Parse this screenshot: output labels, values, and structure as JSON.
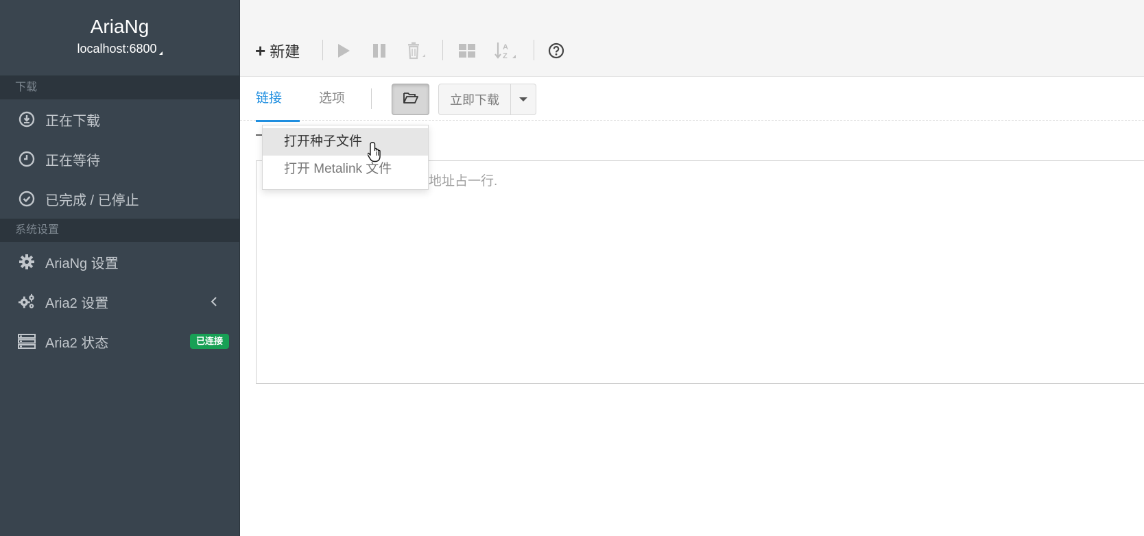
{
  "sidebar": {
    "brand": {
      "title": "AriaNg",
      "host": "localhost:6800"
    },
    "sections": [
      {
        "header": "下载"
      },
      {
        "header": "系统设置"
      }
    ],
    "download_items": [
      {
        "label": "正在下载",
        "icon": "download-circle-icon"
      },
      {
        "label": "正在等待",
        "icon": "clock-icon"
      },
      {
        "label": "已完成 / 已停止",
        "icon": "check-circle-icon"
      }
    ],
    "settings_items": [
      {
        "label": "AriaNg 设置",
        "icon": "gear-icon"
      },
      {
        "label": "Aria2 设置",
        "icon": "gears-icon"
      },
      {
        "label": "Aria2 状态",
        "icon": "server-icon",
        "badge": "已连接"
      }
    ],
    "colors": {
      "background": "#39444e",
      "badge": "#18a055"
    }
  },
  "toolbar": {
    "new_label": "新建",
    "icons": [
      "play-icon",
      "pause-icon",
      "trash-icon",
      "grid-icon",
      "sort-alpha-icon",
      "help-icon"
    ]
  },
  "tabs": {
    "links": "链接",
    "options": "选项"
  },
  "actions": {
    "download_now": "立即下载"
  },
  "dropdown": {
    "items": [
      "打开种子文件",
      "打开 Metalink 文件"
    ]
  },
  "url_input": {
    "placeholder": "地址占一行."
  },
  "accent": "#208fe0"
}
